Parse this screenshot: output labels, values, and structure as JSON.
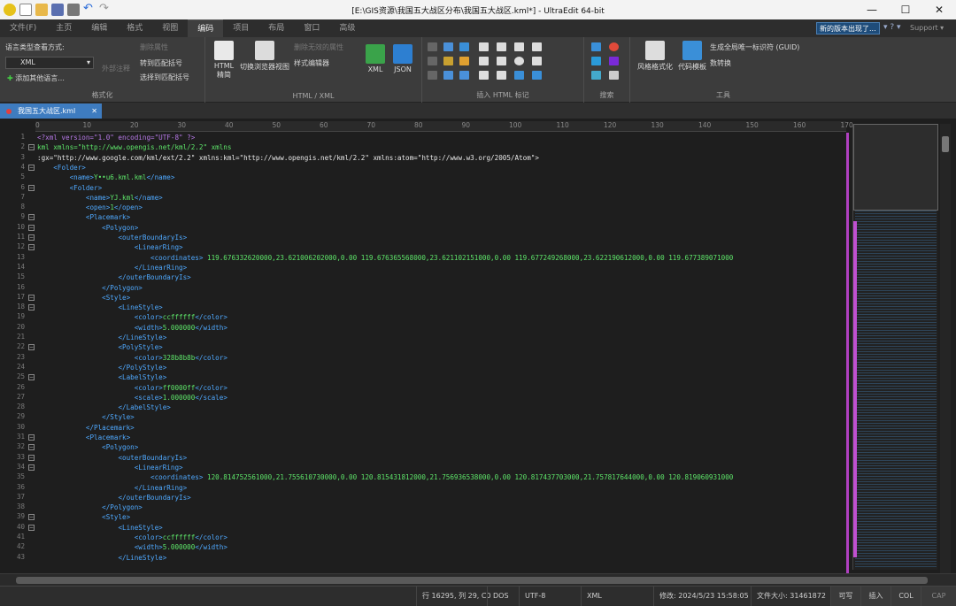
{
  "window": {
    "title": "[E:\\GIS资源\\我国五大战区分布\\我国五大战区.kml*] - UltraEdit 64-bit",
    "minimize": "—",
    "maximize": "☐",
    "close": "✕"
  },
  "menu": {
    "items": [
      "文件(F)",
      "主页",
      "编辑",
      "格式",
      "视图",
      "编码",
      "项目",
      "布局",
      "窗口",
      "高级"
    ],
    "active_index": 5,
    "new_version": "新的版本出现了...",
    "help": "▾ ? ▾",
    "support": "Support ▾"
  },
  "ribbon": {
    "format_group": {
      "label": "格式化",
      "lang_label": "语言类型查看方式:",
      "lang_value": "XML",
      "add_lang": "添加其他语言...",
      "delete_attr": "删除属性",
      "jump_match": "转到匹配括号",
      "select_match": "选择到匹配括号",
      "indent_label": "外部注释"
    },
    "html_group": {
      "label": "HTML / XML",
      "html_tidy": "HTML 精简",
      "switch_browser": "切换浏览器视图",
      "delete_invalid": "删除无效的属性",
      "style_editor": "样式编辑器",
      "xml": "XML",
      "json": "JSON"
    },
    "insert_group": {
      "label": "插入 HTML 标记"
    },
    "search_group": {
      "label": "搜索"
    },
    "tools_group": {
      "label": "工具",
      "style_format": "风格格式化",
      "code_template": "代码模板",
      "gen_guid": "生成全局唯一标识符 (GUID)",
      "convert": "数转换"
    }
  },
  "tab": {
    "filename": "我国五大战区.kml",
    "close": "✕"
  },
  "ruler": [
    "0",
    "10",
    "20",
    "30",
    "40",
    "50",
    "60",
    "70",
    "80",
    "90",
    "100",
    "110",
    "120",
    "130",
    "140",
    "150",
    "160",
    "170"
  ],
  "lines": [
    {
      "n": "1",
      "text": "<?xml version=\"1.0\" encoding=\"UTF-8\" ?>"
    },
    {
      "n": "2",
      "text": "<kml xmlns=\"http://www.opengis.net/kml/2.2\" xmlns"
    },
    {
      "n": "3",
      "text": ":gx=\"http://www.google.com/kml/ext/2.2\" xmlns:kml=\"http://www.opengis.net/kml/2.2\" xmlns:atom=\"http://www.w3.org/2005/Atom\">"
    },
    {
      "n": "4",
      "text": "    <Folder>"
    },
    {
      "n": "5",
      "text": "        <name>Y••u6.kml.kml</name>"
    },
    {
      "n": "6",
      "text": "        <Folder>"
    },
    {
      "n": "7",
      "text": "            <name>YJ.kml</name>"
    },
    {
      "n": "8",
      "text": "            <open>1</open>"
    },
    {
      "n": "9",
      "text": "            <Placemark>"
    },
    {
      "n": "10",
      "text": "                <Polygon>"
    },
    {
      "n": "11",
      "text": "                    <outerBoundaryIs>"
    },
    {
      "n": "12",
      "text": "                        <LinearRing>"
    },
    {
      "n": "13",
      "text": "                            <coordinates> 119.676332620000,23.621006202000,0.00 119.676365568000,23.621102151000,0.00 119.677249268000,23.622190612000,0.00 119.677389071000"
    },
    {
      "n": "14",
      "text": "                        </LinearRing>"
    },
    {
      "n": "15",
      "text": "                    </outerBoundaryIs>"
    },
    {
      "n": "16",
      "text": "                </Polygon>"
    },
    {
      "n": "17",
      "text": "                <Style>"
    },
    {
      "n": "18",
      "text": "                    <LineStyle>"
    },
    {
      "n": "19",
      "text": "                        <color>ccffffff</color>"
    },
    {
      "n": "20",
      "text": "                        <width>5.000000</width>"
    },
    {
      "n": "21",
      "text": "                    </LineStyle>"
    },
    {
      "n": "22",
      "text": "                    <PolyStyle>"
    },
    {
      "n": "23",
      "text": "                        <color>328b8b8b</color>"
    },
    {
      "n": "24",
      "text": "                    </PolyStyle>"
    },
    {
      "n": "25",
      "text": "                    <LabelStyle>"
    },
    {
      "n": "26",
      "text": "                        <color>ff0000ff</color>"
    },
    {
      "n": "27",
      "text": "                        <scale>1.000000</scale>"
    },
    {
      "n": "28",
      "text": "                    </LabelStyle>"
    },
    {
      "n": "29",
      "text": "                </Style>"
    },
    {
      "n": "30",
      "text": "            </Placemark>"
    },
    {
      "n": "31",
      "text": "            <Placemark>"
    },
    {
      "n": "32",
      "text": "                <Polygon>"
    },
    {
      "n": "33",
      "text": "                    <outerBoundaryIs>"
    },
    {
      "n": "34",
      "text": "                        <LinearRing>"
    },
    {
      "n": "35",
      "text": "                            <coordinates> 120.814752561000,21.755610730000,0.00 120.815431812000,21.756936538000,0.00 120.817437703000,21.757817644000,0.00 120.819060931000"
    },
    {
      "n": "36",
      "text": "                        </LinearRing>"
    },
    {
      "n": "37",
      "text": "                    </outerBoundaryIs>"
    },
    {
      "n": "38",
      "text": "                </Polygon>"
    },
    {
      "n": "39",
      "text": "                <Style>"
    },
    {
      "n": "40",
      "text": "                    <LineStyle>"
    },
    {
      "n": "41",
      "text": "                        <color>ccffffff</color>"
    },
    {
      "n": "42",
      "text": "                        <width>5.000000</width>"
    },
    {
      "n": "43",
      "text": "                    </LineStyle>"
    }
  ],
  "fold_lines": [
    "2",
    "4",
    "6",
    "9",
    "10",
    "11",
    "12",
    "17",
    "18",
    "22",
    "25",
    "31",
    "32",
    "33",
    "34",
    "39",
    "40"
  ],
  "status": {
    "position": "行 16295, 列 29, C0",
    "eol": "DOS",
    "encoding": "UTF-8",
    "syntax": "XML",
    "modified": "修改:   2024/5/23 15:58:05",
    "filesize": "文件大小:   31461872",
    "writable": "可写",
    "insert": "插入",
    "col": "COL",
    "cap": "CAP"
  }
}
